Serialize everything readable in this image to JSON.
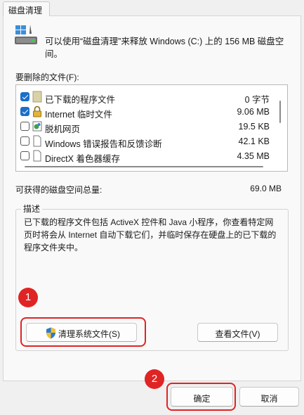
{
  "tab": {
    "label": "磁盘清理"
  },
  "intro_text": "可以使用“磁盘清理”来释放 Windows (C:) 上的 156 MB 磁盘空间。",
  "files_to_delete_label": "要删除的文件(F):",
  "files": [
    {
      "name": "已下载的程序文件",
      "size": "0 字节",
      "checked": true,
      "icon": "folder-icon"
    },
    {
      "name": "Internet 临时文件",
      "size": "9.06 MB",
      "checked": true,
      "icon": "lock-icon"
    },
    {
      "name": "脱机网页",
      "size": "19.5 KB",
      "checked": false,
      "icon": "offline-page-icon"
    },
    {
      "name": "Windows 错误报告和反馈诊断",
      "size": "42.1 KB",
      "checked": false,
      "icon": "document-icon"
    },
    {
      "name": "DirectX 着色器缓存",
      "size": "4.35 MB",
      "checked": false,
      "icon": "document-icon"
    }
  ],
  "total": {
    "label": "可获得的磁盘空间总量:",
    "value": "69.0 MB"
  },
  "description": {
    "title": "描述",
    "text": "已下载的程序文件包括 ActiveX 控件和 Java 小程序，你查看特定网页时将会从 Internet 自动下载它们，并临时保存在硬盘上的已下载的程序文件夹中。"
  },
  "buttons": {
    "clean_system_files": "清理系统文件(S)",
    "view_files": "查看文件(V)",
    "ok": "确定",
    "cancel": "取消"
  },
  "annotations": {
    "badge1": "1",
    "badge2": "2",
    "color": "#e02424"
  },
  "colors": {
    "checkbox_checked": "#1a6fc8"
  }
}
